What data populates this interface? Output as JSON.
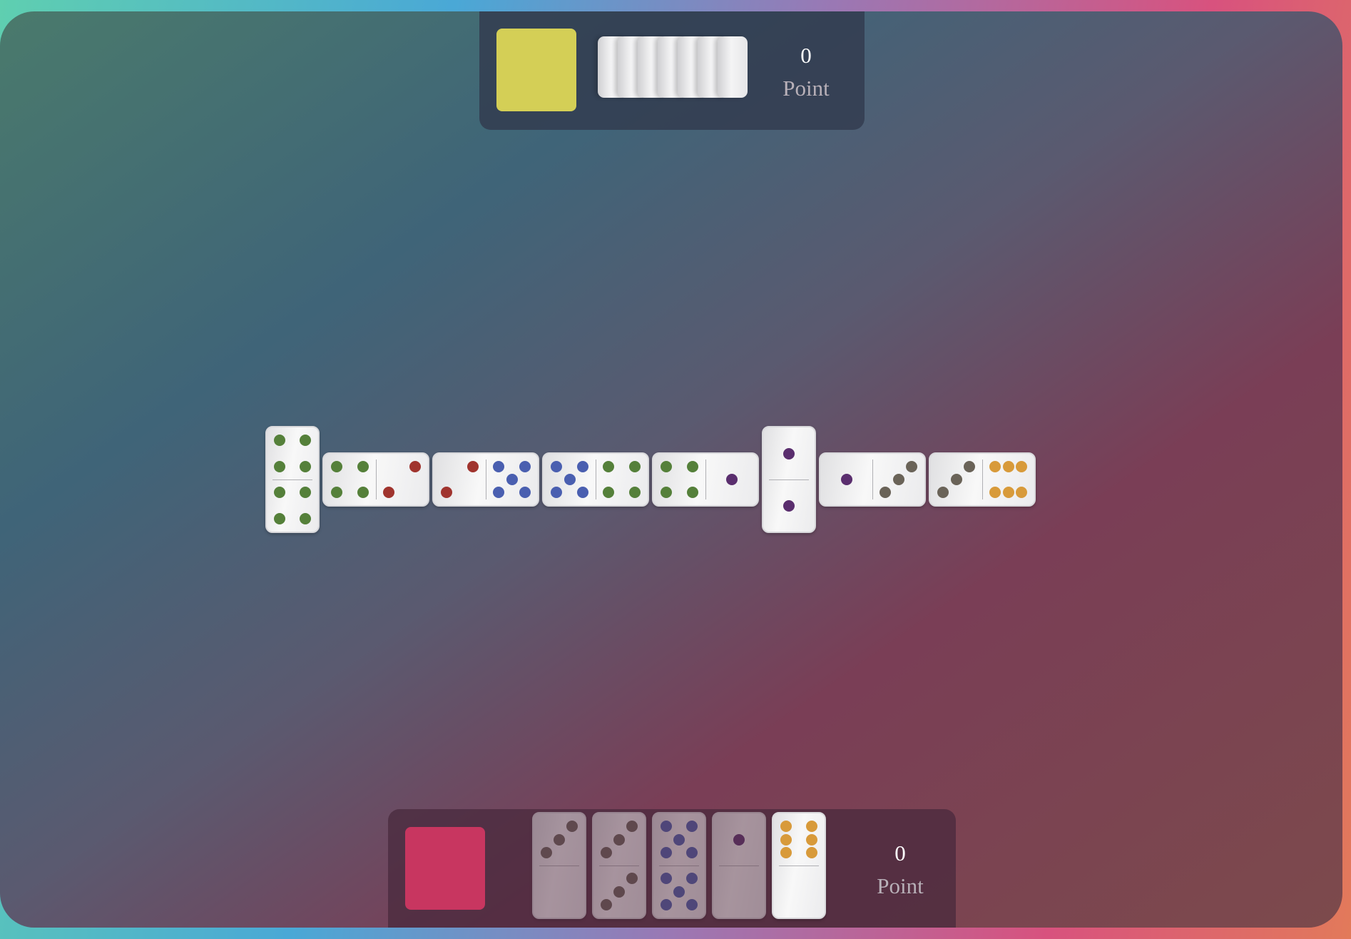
{
  "colors": {
    "opponent_avatar": "#d4cf56",
    "player_avatar": "#c83660"
  },
  "opponent": {
    "score": "0",
    "score_label": "Point",
    "hand_count": 7
  },
  "player": {
    "score": "0",
    "score_label": "Point"
  },
  "pip_colors": {
    "0": "#888888",
    "1": "#5a2e6e",
    "2": "#6a6358",
    "3": "#6a6358",
    "4": "#55803a",
    "5": "#4a5fb0",
    "6": "#d89a3a"
  },
  "board": [
    {
      "a": 4,
      "b": 4,
      "orientation": "vertical"
    },
    {
      "a": 4,
      "b": 2,
      "orientation": "horizontal",
      "colors": [
        "#55803a",
        "#a0342e"
      ]
    },
    {
      "a": 2,
      "b": 5,
      "orientation": "horizontal",
      "colors": [
        "#a0342e",
        "#4a5fb0"
      ]
    },
    {
      "a": 5,
      "b": 4,
      "orientation": "horizontal"
    },
    {
      "a": 4,
      "b": 1,
      "orientation": "horizontal"
    },
    {
      "a": 1,
      "b": 1,
      "orientation": "vertical"
    },
    {
      "a": 1,
      "b": 3,
      "orientation": "horizontal"
    },
    {
      "a": 3,
      "b": 6,
      "orientation": "horizontal"
    }
  ],
  "hand": [
    {
      "a": 3,
      "b": 0,
      "playable": false
    },
    {
      "a": 3,
      "b": 3,
      "playable": false
    },
    {
      "a": 5,
      "b": 5,
      "playable": false
    },
    {
      "a": 1,
      "b": 0,
      "playable": false
    },
    {
      "a": 6,
      "b": 0,
      "playable": true
    }
  ]
}
